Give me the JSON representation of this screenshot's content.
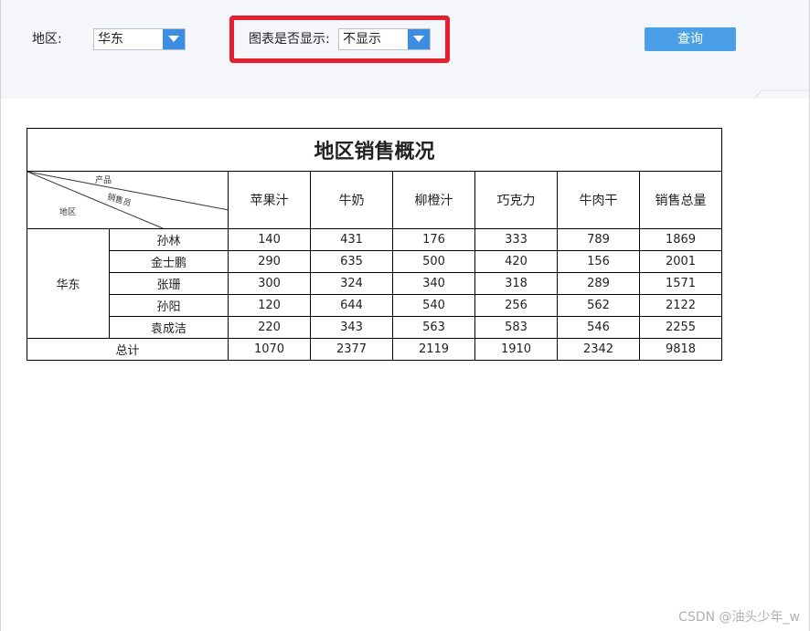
{
  "params": {
    "region_label": "地区:",
    "region_value": "华东",
    "chart_label": "图表是否显示:",
    "chart_value": "不显示",
    "query_button": "查询"
  },
  "report": {
    "title": "地区销售概况",
    "corner": {
      "product": "产品",
      "salesperson": "销售员",
      "region": "地区"
    },
    "columns": [
      "苹果汁",
      "牛奶",
      "柳橙汁",
      "巧克力",
      "牛肉干",
      "销售总量"
    ],
    "region": "华东",
    "rows": [
      {
        "name": "孙林",
        "values": [
          "140",
          "431",
          "176",
          "333",
          "789",
          "1869"
        ]
      },
      {
        "name": "金士鹏",
        "values": [
          "290",
          "635",
          "500",
          "420",
          "156",
          "2001"
        ]
      },
      {
        "name": "张珊",
        "values": [
          "300",
          "324",
          "340",
          "318",
          "289",
          "1571"
        ]
      },
      {
        "name": "孙阳",
        "values": [
          "120",
          "644",
          "540",
          "256",
          "562",
          "2122"
        ]
      },
      {
        "name": "袁成洁",
        "values": [
          "220",
          "343",
          "563",
          "583",
          "546",
          "2255"
        ]
      }
    ],
    "total_label": "总计",
    "totals": [
      "1070",
      "2377",
      "2119",
      "1910",
      "2342",
      "9818"
    ]
  },
  "watermark": "CSDN @油头少年_w",
  "colors": {
    "highlight": "#e5202e",
    "query_button": "#4a9fe6",
    "combo_arrow": "#3d8ee0",
    "param_bg": "#f5f6f9"
  }
}
